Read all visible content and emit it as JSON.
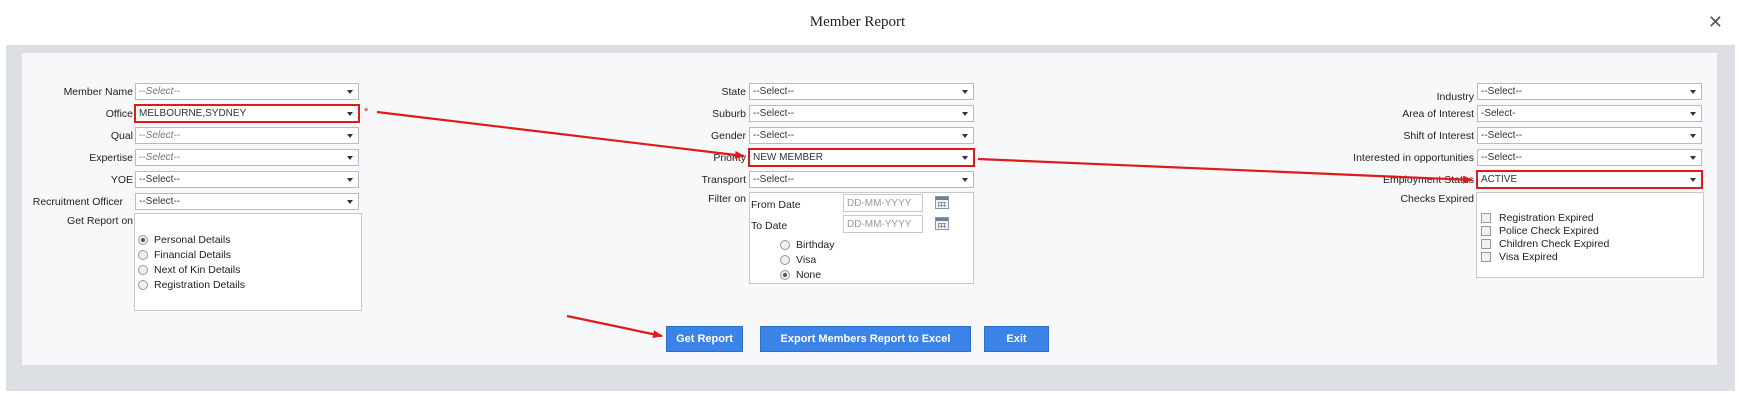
{
  "dialog": {
    "title": "Member Report",
    "close_glyph": "✕"
  },
  "left": {
    "member_name": {
      "label": "Member Name",
      "value": "--Select--"
    },
    "office": {
      "label": "Office",
      "value": "MELBOURNE,SYDNEY",
      "required_mark": "*"
    },
    "qual": {
      "label": "Qual",
      "value": "--Select--"
    },
    "expertise": {
      "label": "Expertise",
      "value": "--Select--"
    },
    "yoe": {
      "label": "YOE",
      "value": "--Select--"
    },
    "recruitment_officer": {
      "label": "Recruitment Officer",
      "value": "--Select--"
    },
    "get_report_on": {
      "label": "Get Report on",
      "options": [
        "Personal Details",
        "Financial Details",
        "Next of Kin Details",
        "Registration Details"
      ],
      "selected": "Personal Details"
    }
  },
  "middle": {
    "state": {
      "label": "State",
      "value": "--Select--"
    },
    "suburb": {
      "label": "Suburb",
      "value": "--Select--"
    },
    "gender": {
      "label": "Gender",
      "value": "--Select--"
    },
    "priority": {
      "label": "Priority",
      "value": "NEW MEMBER"
    },
    "transport": {
      "label": "Transport",
      "value": "--Select--"
    },
    "filter_on": {
      "label": "Filter on",
      "from_label": "From Date",
      "from_placeholder": "DD-MM-YYYY",
      "to_label": "To Date",
      "to_placeholder": "DD-MM-YYYY",
      "options": [
        "Birthday",
        "Visa",
        "None"
      ],
      "selected": "None"
    }
  },
  "right": {
    "industry": {
      "label": "Industry",
      "value": "--Select--"
    },
    "area_of_interest": {
      "label": "Area of Interest",
      "value": "-Select-"
    },
    "shift_of_interest": {
      "label": "Shift of Interest",
      "value": "--Select--"
    },
    "interested_in_opportunities": {
      "label": "Interested in opportunities",
      "value": "--Select--"
    },
    "employment_status": {
      "label": "Employment Status",
      "value": "ACTIVE"
    },
    "checks_expired": {
      "label": "Checks Expired",
      "options": [
        "Registration Expired",
        "Police Check Expired",
        "Children Check Expired",
        "Visa Expired"
      ]
    }
  },
  "buttons": {
    "get_report": "Get Report",
    "export_excel": "Export Members Report to Excel",
    "exit": "Exit"
  },
  "colors": {
    "accent": "#3b83e6",
    "annotation": "#e01a1a",
    "panel": "#f7f8fa",
    "frame": "#dcdfe4"
  }
}
